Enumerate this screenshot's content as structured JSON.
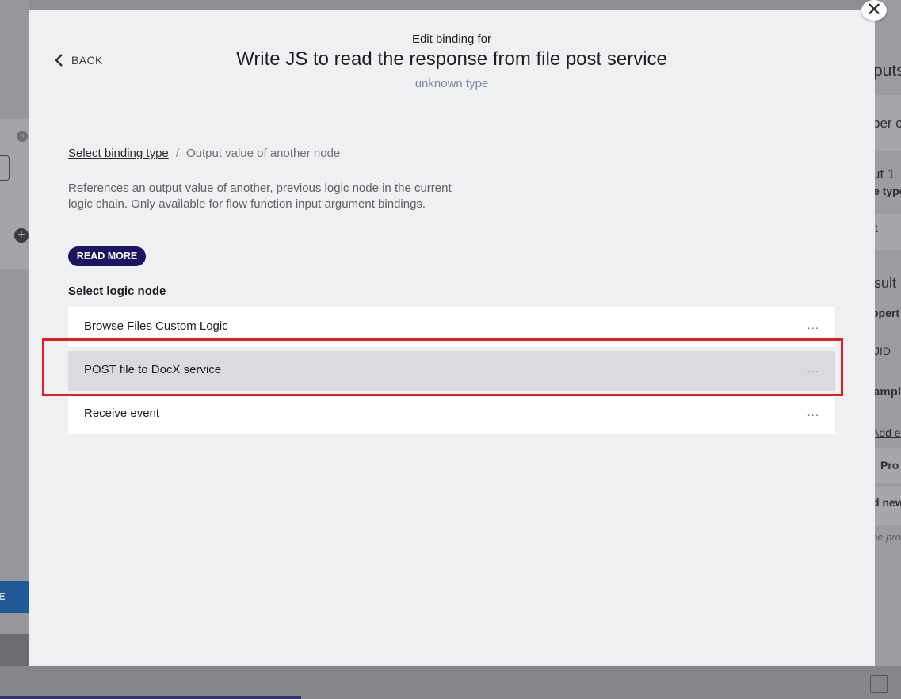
{
  "modal": {
    "back_label": "BACK",
    "header_pre": "Edit binding for",
    "title": "Write JS to read the response from file post service",
    "type_label": "unknown type",
    "close_symbol": "✕"
  },
  "breadcrumb": {
    "link": "Select binding type",
    "separator": "/",
    "current": "Output value of another node"
  },
  "description": "References an output value of another, previous logic node in the current logic chain. Only available for flow function input argument bindings.",
  "read_more_label": "READ MORE",
  "section_title": "Select logic node",
  "logic_nodes": [
    {
      "label": "Browse Files Custom Logic",
      "more": "...",
      "selected": false
    },
    {
      "label": "POST file to DocX service",
      "more": "...",
      "selected": true
    },
    {
      "label": "Receive event",
      "more": "...",
      "selected": false
    }
  ],
  "background": {
    "left_button_text": "E",
    "right_texts": [
      "puts",
      "ber c",
      "ut 1",
      "e type",
      "t",
      "sult",
      "opert",
      "JID",
      "ampl",
      "Add ex",
      "Pro",
      "d new",
      "be pro"
    ]
  },
  "colors": {
    "accent": "#1e1562",
    "highlight": "#e02020",
    "selected_row": "#dadbde"
  },
  "icons": {
    "back": "chevron-left-icon",
    "close": "close-icon",
    "more": "more-horizontal-icon"
  }
}
